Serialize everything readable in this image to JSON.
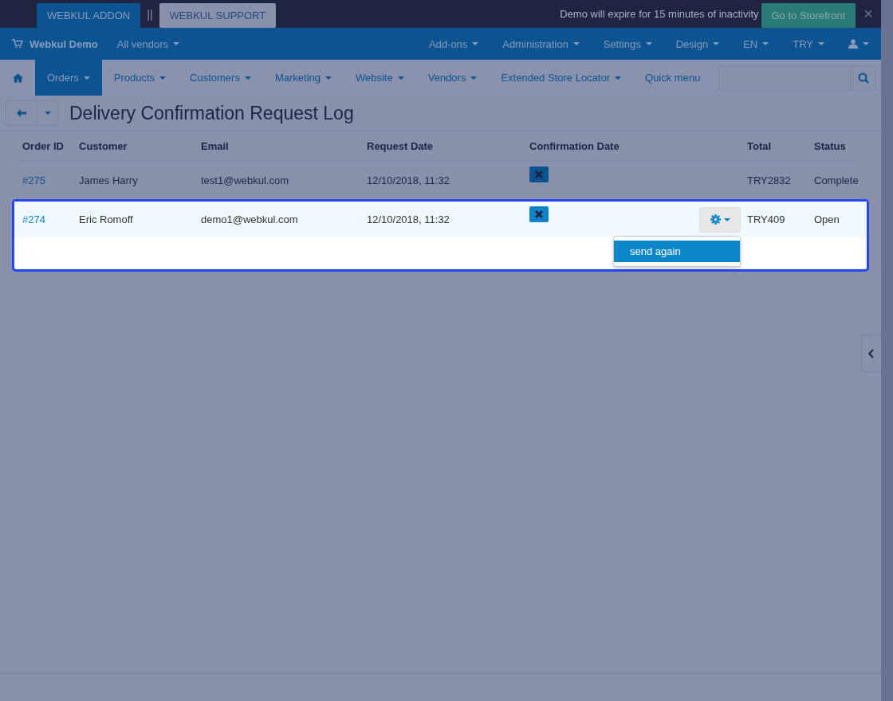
{
  "top_bar": {
    "buttons": [
      {
        "label": "WEBKUL ADDON",
        "selected": true
      },
      {
        "label": "WEBKUL SUPPORT",
        "selected": false
      }
    ],
    "separator": "||",
    "notice": "Demo will expire for 15 minutes of inactivity",
    "storefront_button": "Go to Storefront",
    "close": "×"
  },
  "main_nav": {
    "brand": "Webkul Demo",
    "vendor_menu": "All vendors",
    "menus": [
      "Add-ons",
      "Administration",
      "Settings",
      "Design",
      "EN",
      "TRY"
    ]
  },
  "sub_nav": {
    "items": [
      {
        "label": "Orders",
        "selected": true
      },
      {
        "label": "Products",
        "selected": false
      },
      {
        "label": "Customers",
        "selected": false
      },
      {
        "label": "Marketing",
        "selected": false
      },
      {
        "label": "Website",
        "selected": false
      },
      {
        "label": "Vendors",
        "selected": false
      },
      {
        "label": "Extended Store Locator",
        "selected": false
      }
    ],
    "quick_menu": "Quick menu"
  },
  "page": {
    "title": "Delivery Confirmation Request Log"
  },
  "table": {
    "columns": [
      "Order ID",
      "Customer",
      "Email",
      "Request Date",
      "Confirmation Date",
      "Total",
      "Status"
    ],
    "rows": [
      {
        "order_id": "#275",
        "customer": "James Harry",
        "email": "test1@webkul.com",
        "request_date": "12/10/2018, 11:32",
        "confirmed": false,
        "total": "TRY2832",
        "status": "Complete",
        "highlighted": false
      },
      {
        "order_id": "#274",
        "customer": "Eric Romoff",
        "email": "demo1@webkul.com",
        "request_date": "12/10/2018, 11:32",
        "confirmed": false,
        "total": "TRY409",
        "status": "Open",
        "highlighted": true,
        "actions": {
          "open": true,
          "items": [
            {
              "label": "send again",
              "selected": true
            }
          ]
        }
      }
    ]
  }
}
